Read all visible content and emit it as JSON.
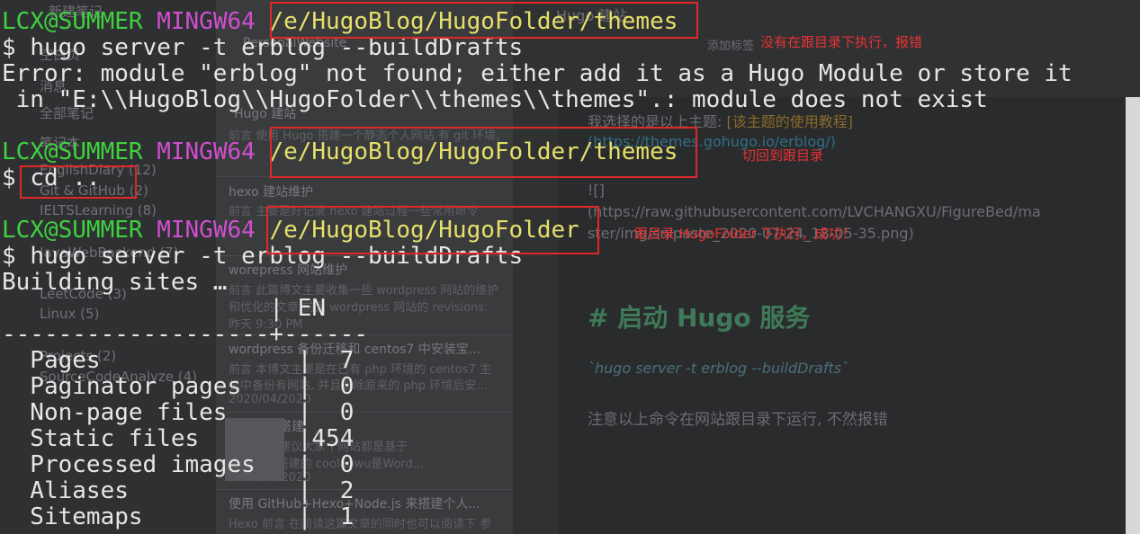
{
  "background_app": {
    "sidebar": {
      "items": [
        "新建笔记",
        "空白页",
        "消息",
        "全部笔记",
        "笔记本",
        "EnglishDiary (12)",
        "Git & GitHub (2)",
        "IELTSLearning (8)",
        "JavaWebBackend (7)",
        "LeetCode (3)",
        "Linux (5)",
        "Projects (2)",
        "SourceCodeAnalyze (4)"
      ]
    },
    "list": {
      "notebook": "PersonalWebsite",
      "add_tag": "添加标签",
      "notes": [
        {
          "title": "Hugo 建站",
          "preview": "前言 使用 Hugo 搭建一个静态个人网站 有 git 环境,"
        },
        {
          "title": "hexo 建站维护",
          "preview": "前言 主要是好记录 hexo 建站过程一些常用命令"
        },
        {
          "title": "worepress 网站维护",
          "preview": "前言 此篇博文主要收集一些 wordpress 网站的维护",
          "preview2": "和优化的文章 前面 wordpress 网站的 revisions:",
          "date": "昨天 9:30 PM"
        },
        {
          "title": "wordpress 备份迁移和 centos7 中安装宝...",
          "preview": "前言 本博文主要是在已有 php 环境的 centos7 主",
          "preview2": "机中备份有网站, 并且删除原来的 php 环境后安...",
          "date": "2020/04/2020"
        },
        {
          "title": "动态网站搭建",
          "preview": "个人建站 建议大家个网站都是基于",
          "preview2": "cpu 时代搭建的 coolaowu是Word...",
          "date": "2020/04/2020"
        },
        {
          "title": "使用 GitHub+Hexo+Node.js 来搭建个人...",
          "preview": "Hexo 前言 在阅读这篇文章的同时也可以阅读下 参"
        }
      ]
    },
    "editor": {
      "title": "Hugo 建站",
      "line1": "我选择的是以上主题: ",
      "link": "[该主题的使用教程]",
      "url": "(https://themes.gohugo.io/erblog/)",
      "img1": "![]",
      "img2": "(https://raw.githubusercontent.com/LVCHANGXU/FigureBed/ma",
      "img3": "ster/img/snipaste_2020-07-24_18-05-35.png)",
      "heading": "# 启动 Hugo 服务",
      "code": "`hugo server -t erblog --buildDrafts`",
      "note": "注意以上命令在网站跟目录下运行, 不然报错"
    }
  },
  "terminal": {
    "user": "LCX@SUMMER",
    "host": "MINGW64",
    "prompt_symbol": "$",
    "blocks": [
      {
        "path": "/e/HugoBlog/HugoFolder/themes",
        "command": "hugo server -t erblog --buildDrafts"
      },
      {
        "path": "/e/HugoBlog/HugoFolder/themes",
        "command": "cd .."
      },
      {
        "path": "/e/HugoBlog/HugoFolder",
        "command": "hugo server -t erblog --buildDrafts"
      }
    ],
    "error_line1": "Error: module \"erblog\" not found; either add it as a Hugo Module or store it",
    "error_line2": " in \"E:\\\\HugoBlog\\\\HugoFolder\\\\themes\\\\themes\".: module does not exist",
    "building": "Building sites …",
    "table_header": "                   | EN",
    "table_rule": "-------------------+------",
    "stats": [
      {
        "label": "  Pages              ",
        "value": "7"
      },
      {
        "label": "  Paginator pages    ",
        "value": "0"
      },
      {
        "label": "  Non-page files     ",
        "value": "0"
      },
      {
        "label": "  Static files       ",
        "value": "454"
      },
      {
        "label": "  Processed images   ",
        "value": "0"
      },
      {
        "label": "  Aliases            ",
        "value": "2"
      },
      {
        "label": "  Sitemaps           ",
        "value": "1"
      }
    ]
  },
  "annotations": {
    "note1": "没有在跟目录下执行，报错",
    "note2": "切回到跟目录",
    "note3": "跟目录 HugoFolder 下执行，成功！",
    "color": "#e02828"
  }
}
